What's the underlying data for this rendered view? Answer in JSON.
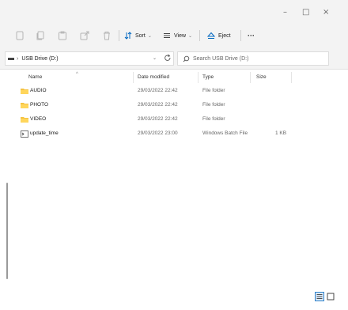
{
  "window": {
    "minimize_glyph": "–",
    "maximize_glyph": "□",
    "close_glyph": "×"
  },
  "toolbar": {
    "sort_label": "Sort",
    "view_label": "View",
    "eject_label": "Eject",
    "more_label": "···"
  },
  "address": {
    "path": "USB Drive (D:)",
    "search_placeholder": "Search USB Drive (D:)"
  },
  "columns": {
    "name": "Name",
    "date": "Date modified",
    "type": "Type",
    "size": "Size"
  },
  "files": [
    {
      "name": "AUDIO",
      "date": "29/03/2022 22:42",
      "type": "File folder",
      "size": "",
      "icon": "folder-icon"
    },
    {
      "name": "PHOTO",
      "date": "29/03/2022 22:42",
      "type": "File folder",
      "size": "",
      "icon": "folder-icon"
    },
    {
      "name": "VIDEO",
      "date": "29/03/2022 22:42",
      "type": "File folder",
      "size": "",
      "icon": "folder-icon"
    },
    {
      "name": "update_time",
      "date": "29/03/2022 23:00",
      "type": "Windows Batch File",
      "size": "1 KB",
      "icon": "batch-file-icon"
    }
  ],
  "colors": {
    "accent": "#0067c0",
    "folder": "#f5c342",
    "chrome": "#f3f3f3"
  }
}
